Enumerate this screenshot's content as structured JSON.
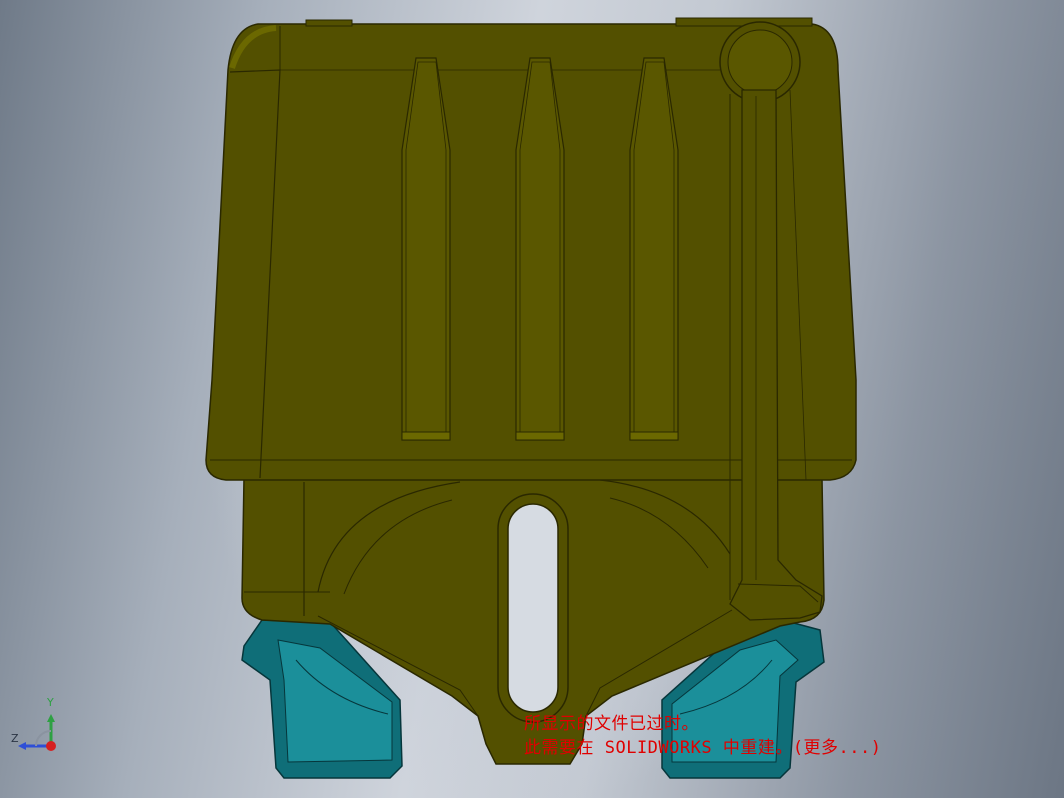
{
  "viewport": {
    "background_colors": [
      "#6f7a88",
      "#cfd4dc",
      "#6c7684"
    ]
  },
  "model": {
    "body_color": "#535000",
    "body_highlight": "#6b6800",
    "edge_color": "#2a2800",
    "feet_color": "#0f6e78",
    "feet_highlight": "#1b8f9a"
  },
  "triad": {
    "y_label": "Y",
    "z_label": "Z"
  },
  "notice": {
    "line1": "所显示的文件已过时。",
    "line2": "此需要在 SOLIDWORKS 中重建。(更多...)"
  }
}
